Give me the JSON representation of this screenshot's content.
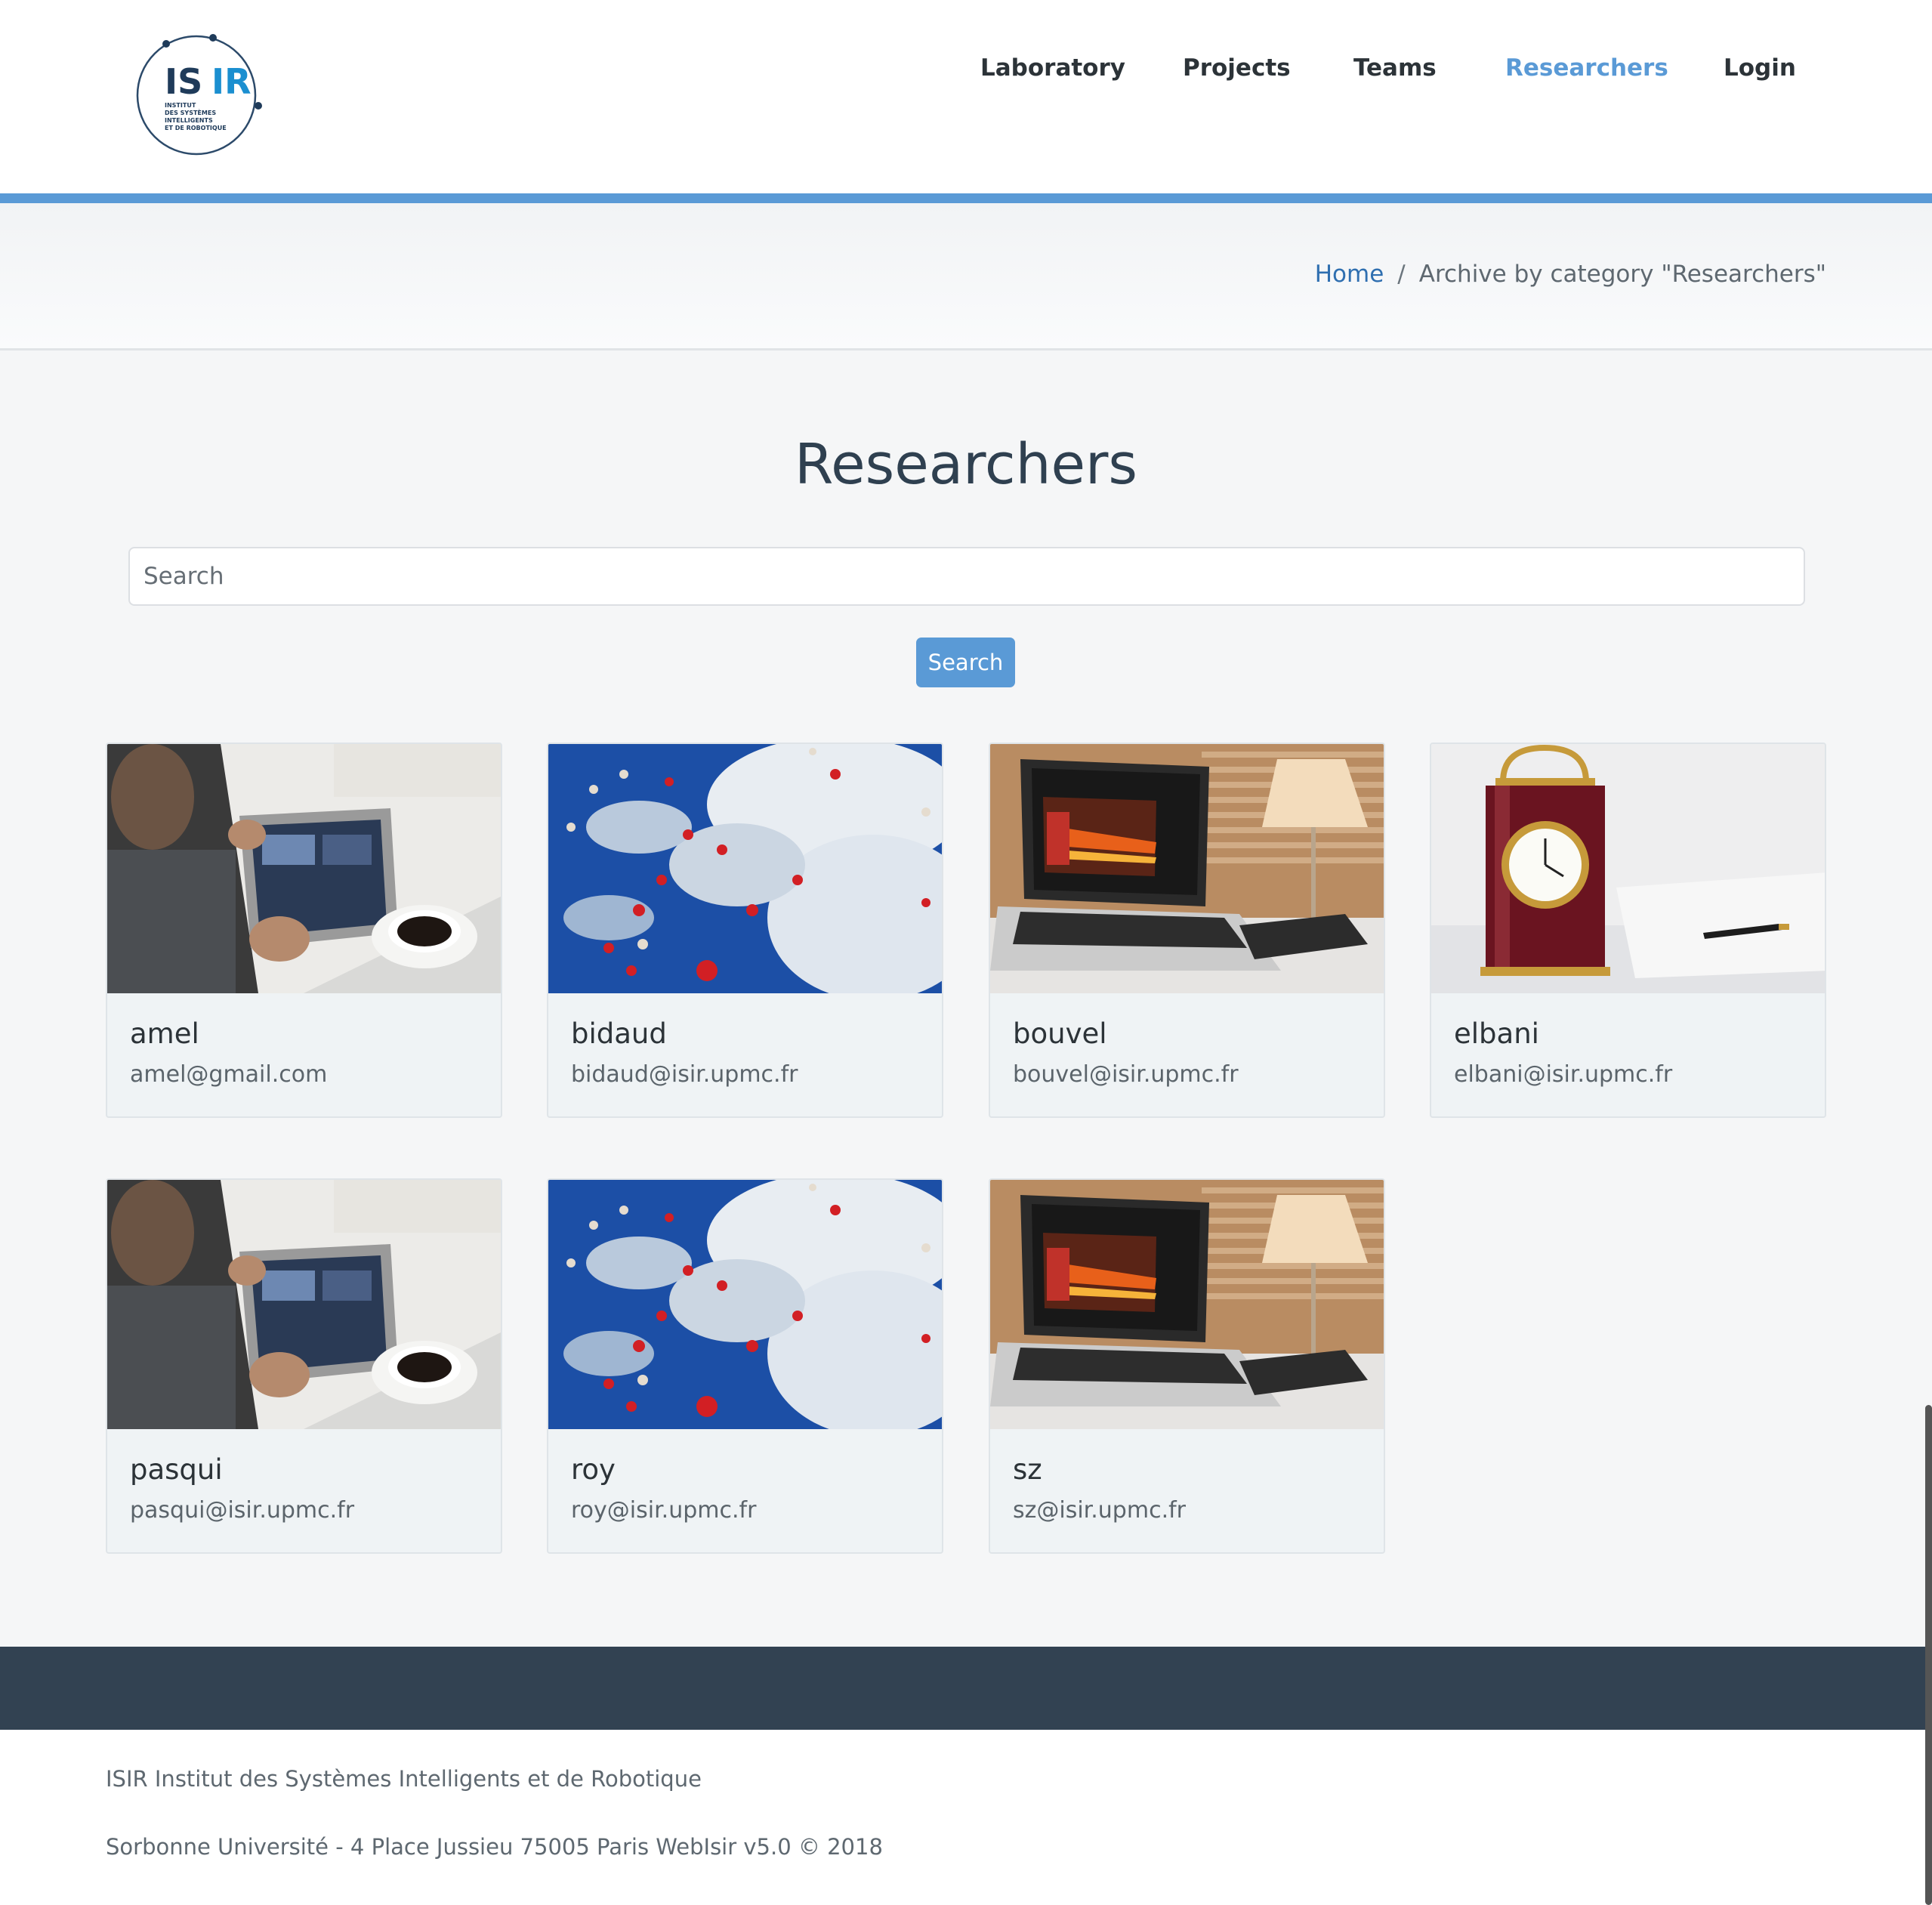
{
  "logo": {
    "text": "ISIR",
    "subtitle_lines": [
      "INSTITUT",
      "DES SYSTÈMES",
      "INTELLIGENTS",
      "ET DE ROBOTIQUE"
    ]
  },
  "nav": {
    "items": [
      {
        "label": "Laboratory",
        "active": false
      },
      {
        "label": "Projects",
        "active": false
      },
      {
        "label": "Teams",
        "active": false
      },
      {
        "label": "Researchers",
        "active": true
      },
      {
        "label": "Login",
        "active": false
      }
    ],
    "accent_color": "#5a9ad6"
  },
  "breadcrumb": {
    "home": "Home",
    "separator": "/",
    "current": "Archive by category \"Researchers\""
  },
  "page": {
    "title": "Researchers"
  },
  "search": {
    "placeholder": "Search",
    "value": "",
    "button_label": "Search"
  },
  "researchers": [
    {
      "name": "amel",
      "email": "amel@gmail.com",
      "image": "tablet-coffee"
    },
    {
      "name": "bidaud",
      "email": "bidaud@isir.upmc.fr",
      "image": "heart-balloons-sky"
    },
    {
      "name": "bouvel",
      "email": "bouvel@isir.upmc.fr",
      "image": "laptop-lamp"
    },
    {
      "name": "elbani",
      "email": "elbani@isir.upmc.fr",
      "image": "clock-notebook"
    },
    {
      "name": "pasqui",
      "email": "pasqui@isir.upmc.fr",
      "image": "tablet-coffee"
    },
    {
      "name": "roy",
      "email": "roy@isir.upmc.fr",
      "image": "heart-balloons-sky"
    },
    {
      "name": "sz",
      "email": "sz@isir.upmc.fr",
      "image": "laptop-lamp"
    }
  ],
  "footer": {
    "line1": "ISIR Institut des Systèmes Intelligents et de Robotique",
    "line2": "Sorbonne Université - 4 Place Jussieu 75005 Paris WebIsir v5.0 © 2018"
  }
}
